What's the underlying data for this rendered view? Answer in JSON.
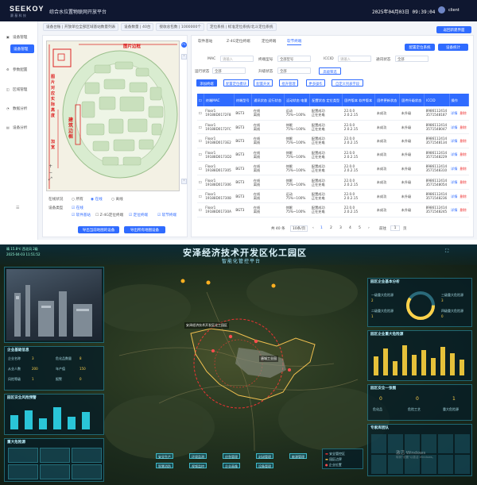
{
  "top": {
    "brand": {
      "logo": "SEEKOY",
      "sub": "赛 基 科 技"
    },
    "app_title": "综合水位置物联网开放平台",
    "datetime": "2025年04月03日 09:39:04",
    "user": "client",
    "nav": [
      {
        "label": "设备管理",
        "active": false
      },
      {
        "label": "设备管理",
        "active": true
      },
      {
        "label": "参数配置",
        "active": false
      },
      {
        "label": "区域管理",
        "active": false
      },
      {
        "label": "数据分析",
        "active": false
      },
      {
        "label": "设备分析",
        "active": false
      }
    ],
    "breadcrumb": [
      "设备台账 | 开放单位全部区域基站数量列表",
      "设备数量 | 40台",
      "接收总包数 | 1000000个",
      "定位系统 | 标准定位系统/北斗定位系统"
    ],
    "return_btn": "返回新建界面",
    "map": {
      "edge_label": "图片边框",
      "side_label_left": "图片对应实际高度",
      "side_label_left2": "加宽",
      "center_label": "建筑边框",
      "online_label": "在线状况",
      "online_opts": [
        "所有",
        "在线",
        "离线"
      ],
      "filter_label": "设备类型",
      "filter_opts": [
        "在线",
        "软件基站",
        "Z-4G定位终端",
        "定位终端",
        "软节终端"
      ],
      "btn_current": "导出当前地图的设备",
      "btn_all": "导出所有地图设备"
    },
    "tabs": [
      "软件基站",
      "Z-4G定位终端",
      "定位终端",
      "软节终端"
    ],
    "right_btns": [
      "配置定位系统",
      "设备统计"
    ],
    "filters": {
      "mac": "MAC",
      "mac_ph": "请输入",
      "code": "终端型号",
      "code_val": "全部型号",
      "iccid": "ICCID",
      "iccid_ph": "请输入",
      "status": "通讯状态",
      "status_val": "全部",
      "run": "运行状态",
      "run_val": "全部",
      "gps": "升级状态",
      "gps_val": "全部",
      "adv": "高级筛选"
    },
    "toolbar": [
      "添加终端",
      "配置定位模块",
      "配置开关",
      "批升管理",
      "更多操作",
      "自定义列表字段"
    ],
    "columns": [
      "终端MAC",
      "终端型号",
      "通讯状态 运行状态",
      "运动状态 电量",
      "配置状态 定位类型",
      "固件版本 软件版本",
      "固件更新状态",
      "固件升级状态",
      "ICCID",
      "操作"
    ],
    "rows": [
      {
        "mac": "Floor1\n19188D0172F8",
        "model": "BGT3",
        "comm": "在线\n离线",
        "motion": "运动\n75%~100%",
        "cfg": "配置成功\n正在充电",
        "fw": "22.0.0\n2.0.2.15",
        "upd": "未成功",
        "up": "未升级",
        "iccid": "8986112414\n3571548187"
      },
      {
        "mac": "Floor1\n19188D0172FC",
        "model": "BGT3",
        "comm": "在线\n离线",
        "motion": "休眠\n75%~100%",
        "cfg": "配置成功\n正在充电",
        "fw": "22.0.0\n2.0.2.15",
        "upd": "未成功",
        "up": "未升级",
        "iccid": "8986112414\n3571548047"
      },
      {
        "mac": "Floor1\n19188D0173E2",
        "model": "BGT3",
        "comm": "在线\n离线",
        "motion": "休眠\n75%~100%",
        "cfg": "配置成功\n正在充电",
        "fw": "22.0.0\n2.0.2.15",
        "upd": "未成功",
        "up": "未升级",
        "iccid": "8986112414\n3571548134"
      },
      {
        "mac": "Floor1\n19188D0173D2",
        "model": "BGT3",
        "comm": "在线\n离线",
        "motion": "休眠\n75%~100%",
        "cfg": "配置成功\n正在充电",
        "fw": "22.0.0\n2.0.2.15",
        "upd": "未成功",
        "up": "未升级",
        "iccid": "8986112414\n3571548229"
      },
      {
        "mac": "Floor1\n19188D017305",
        "model": "BGT3",
        "comm": "在线\n离线",
        "motion": "休眠\n75%~100%",
        "cfg": "配置成功\n正在充电",
        "fw": "22.0.0\n2.0.2.15",
        "upd": "未成功",
        "up": "未升级",
        "iccid": "8986112414\n3571548310"
      },
      {
        "mac": "Floor1\n19188D017306",
        "model": "BGT3",
        "comm": "在线\n离线",
        "motion": "休眠\n75%~100%",
        "cfg": "配置成功\n正在充电",
        "fw": "22.0.0\n2.0.2.15",
        "upd": "未成功",
        "up": "未升级",
        "iccid": "8986112414\n3571548054"
      },
      {
        "mac": "Floor1\n19188D017308",
        "model": "BGT3",
        "comm": "在线\n离线",
        "motion": "运动\n75%~100%",
        "cfg": "配置成功\n正在充电",
        "fw": "22.0.0\n2.0.2.15",
        "upd": "未成功",
        "up": "未升级",
        "iccid": "8986112414\n3571548236"
      },
      {
        "mac": "Floor1\n19188D01730A",
        "model": "BGT3",
        "comm": "在线\n离线",
        "motion": "休眠\n75%~100%",
        "cfg": "配置成功\n正在充电",
        "fw": "22.0.0\n2.0.2.15",
        "upd": "未成功",
        "up": "未升级",
        "iccid": "8986112414\n3571548245"
      }
    ],
    "ops": {
      "detail": "详情",
      "del": "删除"
    },
    "pager": {
      "total": "共 40 条",
      "size": "10条/页",
      "pages": [
        "1",
        "2",
        "3",
        "4",
        "5"
      ],
      "goto": "前往",
      "page": "1",
      "suffix": "页"
    }
  },
  "bottom": {
    "title": "安泽经济技术开发区化工园区",
    "subtitle": "智能化管控平台",
    "weather": "晴 15.8℃ 西北风 2级",
    "date": "2025-04-03 11:51:52",
    "left_panels": [
      "企业基础信息",
      "园区安全风险预警",
      "重大危险源"
    ],
    "left_rows": [
      [
        "企业名称",
        "3",
        "危化品数量",
        "8"
      ],
      [
        "从业人数",
        "200",
        "年产值",
        "150"
      ],
      [
        "风险等级",
        "1",
        "报警",
        "0"
      ]
    ],
    "map_label_1": "安泽经济技术开发区化工园区",
    "map_label_2": "唐城工业园",
    "right_panels": [
      "园区企业基本分析",
      "园区企业重大危险源",
      "园区安全一张图",
      "专家库团队"
    ],
    "right_kv": [
      [
        "一级重大危险源",
        "2"
      ],
      [
        "二级重大危险源",
        "1"
      ],
      [
        "三级重大危险源",
        "3"
      ],
      [
        "四级重大危险源",
        "0"
      ]
    ],
    "right_counts": [
      "0",
      "0",
      "1"
    ],
    "right_count_lbls": [
      "危化品",
      "危险工艺",
      "重大危险源"
    ],
    "bottom_nav": [
      "安全生产",
      "环境监测",
      "应急管理",
      "封闭管理",
      "能源管理",
      "智慧消防",
      "视频监控",
      "企业画像",
      "设备管理"
    ],
    "legend": [
      "安全管控区",
      "园区边界",
      "企业位置"
    ],
    "watermark": "激活 Windows",
    "watermark2": "转到\"设置\"以激活 Windows。"
  },
  "colors": {
    "primary": "#2f6bff",
    "header": "#0f1730",
    "danger": "#e33",
    "cyan": "#3fb9c9"
  }
}
